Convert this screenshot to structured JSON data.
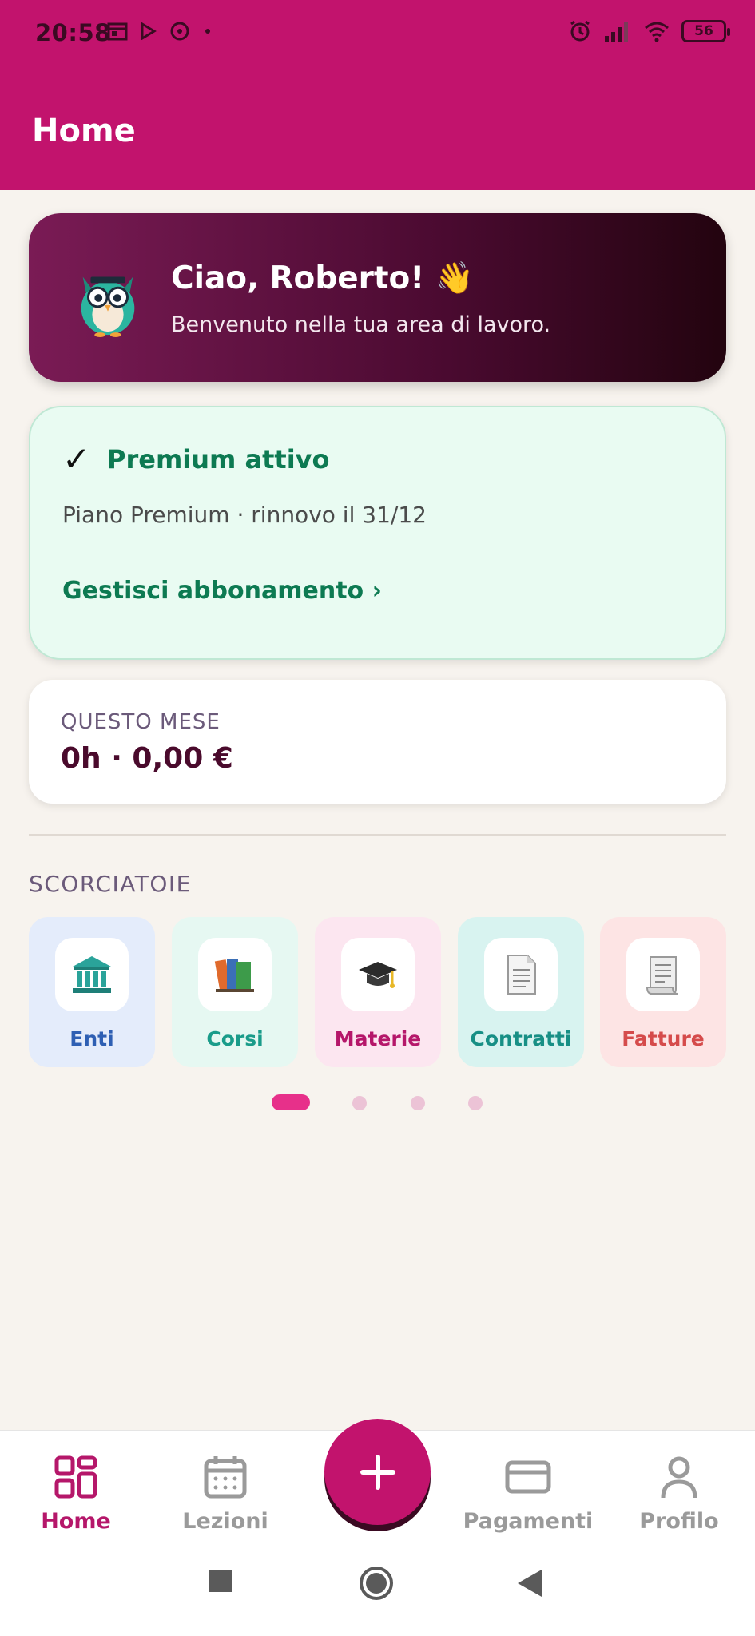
{
  "status_bar": {
    "time": "20:58",
    "battery": "56",
    "left_icons": [
      "calendar-icon",
      "play-icon",
      "cloud-icon",
      "dot-icon"
    ],
    "right_icons": [
      "alarm-icon",
      "signal-icon",
      "wifi-icon",
      "battery-icon"
    ]
  },
  "app_bar": {
    "title": "Home"
  },
  "greeting": {
    "title": "Ciao, Roberto! 👋",
    "subtitle": "Benvenuto nella tua area di lavoro.",
    "avatar": "owl-mascot-icon"
  },
  "premium": {
    "check": "✓",
    "title": "Premium attivo",
    "subtitle": "Piano Premium · rinnovo il 31/12",
    "link": "Gestisci abbonamento ›"
  },
  "month": {
    "label": "QUESTO MESE",
    "value": "0h · 0,00 €"
  },
  "shortcuts": {
    "label": "SCORCIATOIE",
    "items": [
      {
        "label": "Enti",
        "icon": "bank-icon",
        "color": "#2e5fb3",
        "bg": "#e4ecfb"
      },
      {
        "label": "Corsi",
        "icon": "books-icon",
        "color": "#1a9c8a",
        "bg": "#e6f8f2"
      },
      {
        "label": "Materie",
        "icon": "graduation-cap-icon",
        "color": "#b5176a",
        "bg": "#fce6f0"
      },
      {
        "label": "Contratti",
        "icon": "document-icon",
        "color": "#178f85",
        "bg": "#d8f3f0"
      },
      {
        "label": "Fatture",
        "icon": "receipt-icon",
        "color": "#d54b4b",
        "bg": "#fde4e4"
      }
    ],
    "page_count": 4,
    "active_page": 1
  },
  "bottom_nav": {
    "items": [
      {
        "label": "Home",
        "icon": "grid-icon",
        "active": true
      },
      {
        "label": "Lezioni",
        "icon": "calendar-icon",
        "active": false
      },
      {
        "label": "Pagamenti",
        "icon": "credit-card-icon",
        "active": false
      },
      {
        "label": "Profilo",
        "icon": "user-icon",
        "active": false
      }
    ],
    "fab_icon": "plus-icon"
  },
  "colors": {
    "brand": "#c2136d",
    "premium_green": "#0d7a52",
    "background": "#f7f3ee"
  }
}
